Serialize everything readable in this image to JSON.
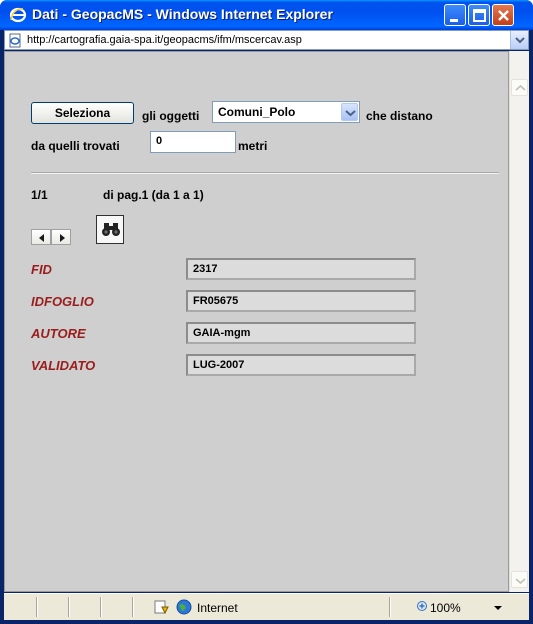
{
  "window": {
    "title": "Dati - GeopacMS - Windows Internet Explorer",
    "url": "http://cartografia.gaia-spa.it/geopacms/ifm/mscercav.asp"
  },
  "query": {
    "select_button": "Seleziona",
    "label_objects": "gli oggetti",
    "layer_selected": "Comuni_Polo",
    "label_distance": "che distano",
    "label_from_found": "da quelli trovati",
    "distance_value": "0",
    "label_unit": "metri"
  },
  "results": {
    "counter": "1/1",
    "page_info": "di pag.1  (da 1 a 1)"
  },
  "fields": [
    {
      "label": "FID",
      "value": "2317"
    },
    {
      "label": "IDFOGLIO",
      "value": "FR05675"
    },
    {
      "label": "AUTORE",
      "value": "GAIA-mgm"
    },
    {
      "label": "VALIDATO",
      "value": "LUG-2007"
    }
  ],
  "status": {
    "zone": "Internet",
    "zoom": "100%"
  },
  "icons": {
    "title": "ie-logo-icon",
    "address": "page-icon",
    "find": "binoculars-icon",
    "prev": "arrow-left-icon",
    "next": "arrow-right-icon",
    "protected_mode": "shield-warning-icon",
    "zone": "globe-icon",
    "zoom": "zoom-icon"
  }
}
